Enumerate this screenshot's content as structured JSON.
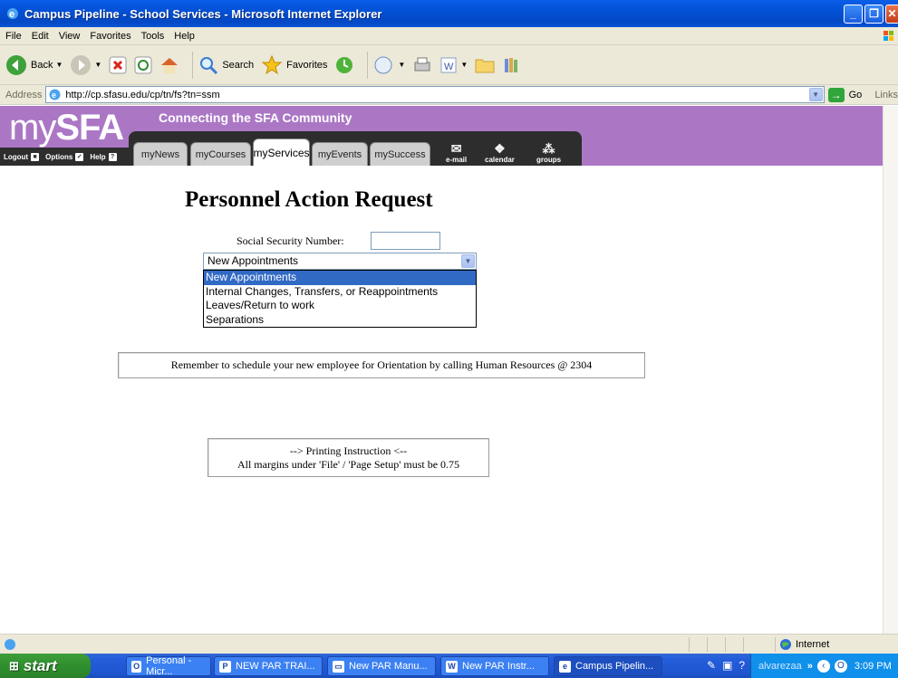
{
  "window": {
    "title": "Campus Pipeline - School Services - Microsoft Internet Explorer",
    "minimize": "_",
    "maximize": "❐",
    "close": "✕"
  },
  "menu": [
    "File",
    "Edit",
    "View",
    "Favorites",
    "Tools",
    "Help"
  ],
  "toolbar": {
    "back": "Back",
    "search": "Search",
    "favorites": "Favorites"
  },
  "address": {
    "label": "Address",
    "url": "http://cp.sfasu.edu/cp/tn/fs?tn=ssm",
    "go": "Go",
    "links": "Links"
  },
  "portal": {
    "logo_my": "my",
    "logo_sfa": "SFA",
    "tagline": "Connecting the SFA Community",
    "util": {
      "logout": "Logout",
      "options": "Options",
      "help": "Help"
    },
    "tabs": [
      "myNews",
      "myCourses",
      "myServices",
      "myEvents",
      "mySuccess"
    ],
    "active_tab": "myServices",
    "icons": {
      "email": "e-mail",
      "calendar": "calendar",
      "groups": "groups"
    }
  },
  "form": {
    "title": "Personnel Action Request",
    "ssn_label": "Social Security Number:",
    "ssn_value": "",
    "selected_option": "New Appointments",
    "options": [
      "New Appointments",
      "Internal Changes, Transfers, or Reappointments",
      "Leaves/Return to work",
      "Separations"
    ],
    "orientation_notice": "Remember to schedule your new employee for Orientation by calling Human Resources @ 2304",
    "print_heading": "--> Printing Instruction <--",
    "print_text": "All margins under 'File' / 'Page Setup' must be 0.75"
  },
  "status": {
    "zone": "Internet"
  },
  "taskbar": {
    "start": "start",
    "tasks": [
      "Personal - Micr...",
      "NEW PAR TRAI...",
      "New PAR Manu...",
      "New PAR Instr...",
      "Campus Pipelin..."
    ],
    "tray_user": "alvarezaa",
    "clock": "3:09 PM"
  },
  "colors": {
    "portal_purple": "#ab77c5",
    "xp_blue": "#0351d6",
    "selection": "#316ac5"
  }
}
